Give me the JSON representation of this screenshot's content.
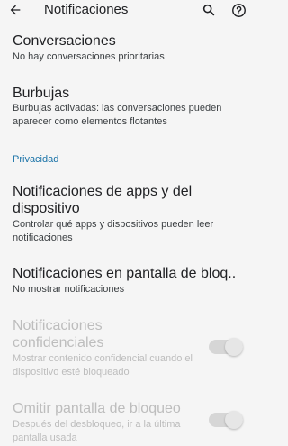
{
  "appbar": {
    "title": "Notificaciones",
    "icons": [
      "back-arrow-icon",
      "search-icon",
      "help-icon"
    ]
  },
  "items": [
    {
      "title": "Conversaciones",
      "subtitle": "No hay conversaciones prioritarias"
    },
    {
      "title": "Burbujas",
      "subtitle": "Burbujas activadas: las conversaciones pueden aparecer como elementos flotantes"
    }
  ],
  "section_privacy": "Privacidad",
  "privacy_items": [
    {
      "title": "Notificaciones de apps y del dispositivo",
      "subtitle": "Controlar qué apps y dispositivos pueden leer notificaciones"
    },
    {
      "title": "Notificaciones en pantalla de bloq..",
      "subtitle": "No mostrar notificaciones"
    },
    {
      "title": "Notificaciones confidenciales",
      "subtitle": "Mostrar contenido confidencial cuando el dispositivo esté bloqueado",
      "enabled": false,
      "toggle_on": false
    },
    {
      "title": "Omitir pantalla de bloqueo",
      "subtitle": "Después del desbloqueo, ir a la última pantalla usada",
      "enabled": false,
      "toggle_on": false
    }
  ]
}
